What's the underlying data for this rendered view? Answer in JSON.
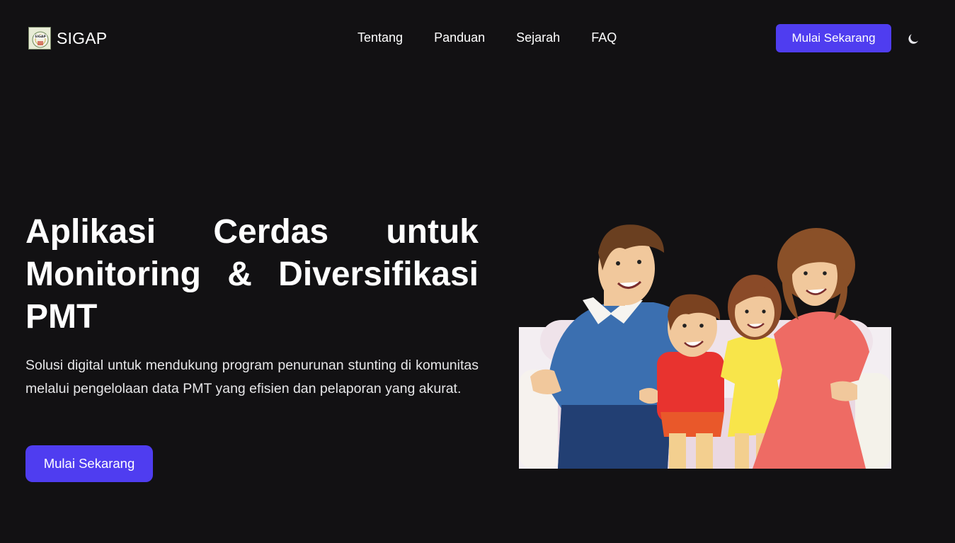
{
  "brand": {
    "name": "SIGAP",
    "logo_text": "SIGAP",
    "logo_icon": "sigap-logo"
  },
  "nav": {
    "items": [
      {
        "label": "Tentang"
      },
      {
        "label": "Panduan"
      },
      {
        "label": "Sejarah"
      },
      {
        "label": "FAQ"
      }
    ],
    "cta_label": "Mulai Sekarang",
    "theme_toggle_icon": "moon-icon"
  },
  "hero": {
    "title": "Aplikasi Cerdas untuk Monitoring & Diversifikasi PMT",
    "description": "Solusi digital untuk mendukung program penurunan stunting di komunitas melalui pengelolaan data PMT yang efisien dan pelaporan yang akurat.",
    "cta_label": "Mulai Sekarang",
    "illustration": "family-illustration"
  },
  "colors": {
    "background": "#121113",
    "primary": "#4f3df0",
    "text": "#ffffff"
  }
}
